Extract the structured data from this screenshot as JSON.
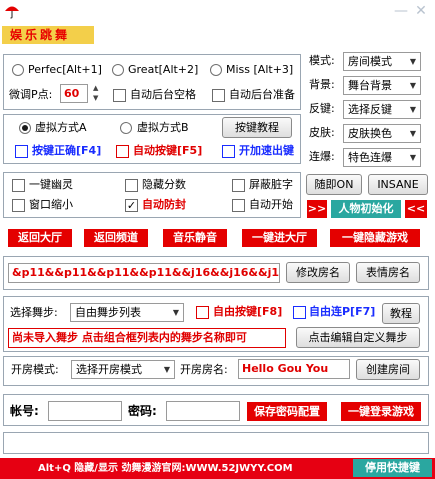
{
  "banner": "娱乐跳舞",
  "window_controls": {
    "minimize": "—",
    "close": "✕"
  },
  "modes": {
    "perfect": "Perfec[Alt+1]",
    "great": "Great[Alt+2]",
    "miss": "Miss [Alt+3]",
    "adjust_label": "微调P点:",
    "adjust_value": "60",
    "auto_space": "自动后台空格",
    "auto_ready": "自动后台准备"
  },
  "sim": {
    "a": "虚拟方式A",
    "b": "虚拟方式B",
    "tutorial": "按键教程",
    "key_correct": "按键正确[F4]",
    "auto_key": "自动按键[F5]",
    "speed": "开加速出键"
  },
  "options": {
    "ghost": "一键幽灵",
    "hide_score": "隐藏分数",
    "block_words": "屏蔽脏字",
    "window_min": "窗口缩小",
    "anti_seal": "自动防封",
    "auto_start": "自动开始",
    "instant_on": "随即ON",
    "insane": "INSANE",
    "left_arrows": ">>",
    "character_init": "人物初始化",
    "right_arrows": "<<"
  },
  "right_panel": {
    "room_mode_label": "模式:",
    "room_mode_value": "房间模式",
    "background_label": "背景:",
    "background_value": "舞台背景",
    "key_label": "反键:",
    "key_value": "选择反键",
    "skin_label": "皮肤:",
    "skin_value": "皮肤换色",
    "combo_label": "连爆:",
    "combo_value": "特色连爆"
  },
  "quick_buttons": [
    "返回大厅",
    "返回频道",
    "音乐静音",
    "一键进大厅",
    "一键隐藏游戏"
  ],
  "room_name": {
    "value": "&p11&&p11&&p11&&p11&&j16&&j16&&j16&&",
    "modify": "修改房名",
    "emoji": "表情房名"
  },
  "dance": {
    "label": "选择舞步:",
    "select_value": "自由舞步列表",
    "auto_key": "自由按键[F8]",
    "auto_link": "自由连P[F7]",
    "tutorial": "教程",
    "notice": "尚未导入舞步 点击组合框列表内的舞步名称即可",
    "edit": "点击编辑自定义舞步"
  },
  "open_room": {
    "mode_label": "开房模式:",
    "mode_value": "选择开房模式",
    "name_label": "开房房名:",
    "name_value": "Hello Gou You",
    "create": "创建房间"
  },
  "login": {
    "account_label": "帐号:",
    "password_label": "密码:",
    "save": "保存密码配置",
    "login": "一键登录游戏"
  },
  "status": {
    "text": "Alt+Q 隐藏/显示  劲舞漫游官网:WWW.52JWYY.COM",
    "hotkey": "停用快捷键"
  },
  "colors": {
    "accent_red": "#e40000",
    "banner_yellow": "#f3cf4a",
    "hotkey_teal": "#2aa7a0"
  }
}
